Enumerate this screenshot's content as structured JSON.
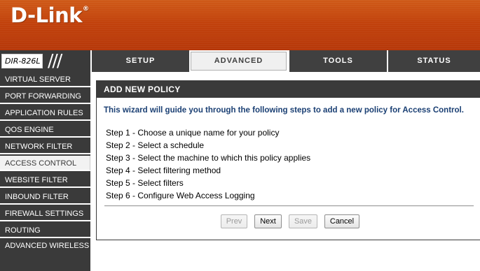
{
  "brand": {
    "logo_text": "D-Link",
    "registered_mark": "®",
    "model": "DIR-826L",
    "separator": "///"
  },
  "nav": {
    "tabs": [
      {
        "label": "SETUP",
        "active": false
      },
      {
        "label": "ADVANCED",
        "active": true
      },
      {
        "label": "TOOLS",
        "active": false
      },
      {
        "label": "STATUS",
        "active": false
      }
    ]
  },
  "sidebar": {
    "items": [
      {
        "label": "VIRTUAL SERVER",
        "active": false
      },
      {
        "label": "PORT FORWARDING",
        "active": false
      },
      {
        "label": "APPLICATION RULES",
        "active": false
      },
      {
        "label": "QOS ENGINE",
        "active": false
      },
      {
        "label": "NETWORK FILTER",
        "active": false
      },
      {
        "label": "ACCESS CONTROL",
        "active": true
      },
      {
        "label": "WEBSITE FILTER",
        "active": false
      },
      {
        "label": "INBOUND FILTER",
        "active": false
      },
      {
        "label": "FIREWALL SETTINGS",
        "active": false
      },
      {
        "label": "ROUTING",
        "active": false
      },
      {
        "label": "ADVANCED WIRELESS",
        "active": false
      }
    ]
  },
  "main": {
    "panel_title": "ADD NEW POLICY",
    "intro": "This wizard will guide you through the following steps to add a new policy for Access Control.",
    "steps": [
      "Step 1 - Choose a unique name for your policy",
      "Step 2 - Select a schedule",
      "Step 3 - Select the machine to which this policy applies",
      "Step 4 - Select filtering method",
      "Step 5 - Select filters",
      "Step 6 - Configure Web Access Logging"
    ],
    "buttons": {
      "prev": {
        "label": "Prev",
        "enabled": false
      },
      "next": {
        "label": "Next",
        "enabled": true
      },
      "save": {
        "label": "Save",
        "enabled": false
      },
      "cancel": {
        "label": "Cancel",
        "enabled": true
      }
    }
  },
  "colors": {
    "banner_orange": "#c2420c",
    "nav_dark": "#3a3a3a",
    "intro_blue": "#1a3f73",
    "active_bg": "#f2f2f2"
  }
}
